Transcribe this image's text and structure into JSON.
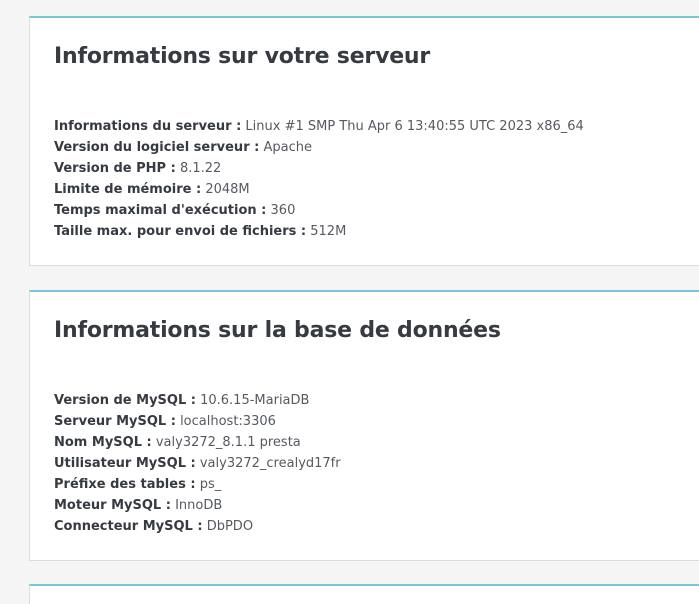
{
  "server_panel": {
    "title": "Informations sur votre serveur",
    "rows": [
      {
        "label": "Informations du serveur :",
        "value": "Linux #1 SMP Thu Apr 6 13:40:55 UTC 2023 x86_64"
      },
      {
        "label": "Version du logiciel serveur :",
        "value": "Apache"
      },
      {
        "label": "Version de PHP :",
        "value": "8.1.22"
      },
      {
        "label": "Limite de mémoire :",
        "value": "2048M"
      },
      {
        "label": "Temps maximal d'exécution :",
        "value": "360"
      },
      {
        "label": "Taille max. pour envoi de fichiers :",
        "value": "512M"
      }
    ]
  },
  "database_panel": {
    "title": "Informations sur la base de données",
    "rows": [
      {
        "label": "Version de MySQL :",
        "value": "10.6.15-MariaDB"
      },
      {
        "label": "Serveur MySQL :",
        "value": "localhost:3306"
      },
      {
        "label": "Nom MySQL :",
        "value": "valy3272_8.1.1 presta"
      },
      {
        "label": "Utilisateur MySQL :",
        "value": "valy3272_crealyd17fr"
      },
      {
        "label": "Préfixe des tables :",
        "value": "ps_"
      },
      {
        "label": "Moteur MySQL :",
        "value": "InnoDB"
      },
      {
        "label": "Connecteur MySQL :",
        "value": "DbPDO"
      }
    ]
  },
  "colors": {
    "page_background": "#f5f5f5",
    "panel_accent": "#7cc5d9",
    "text": "#363a41"
  }
}
